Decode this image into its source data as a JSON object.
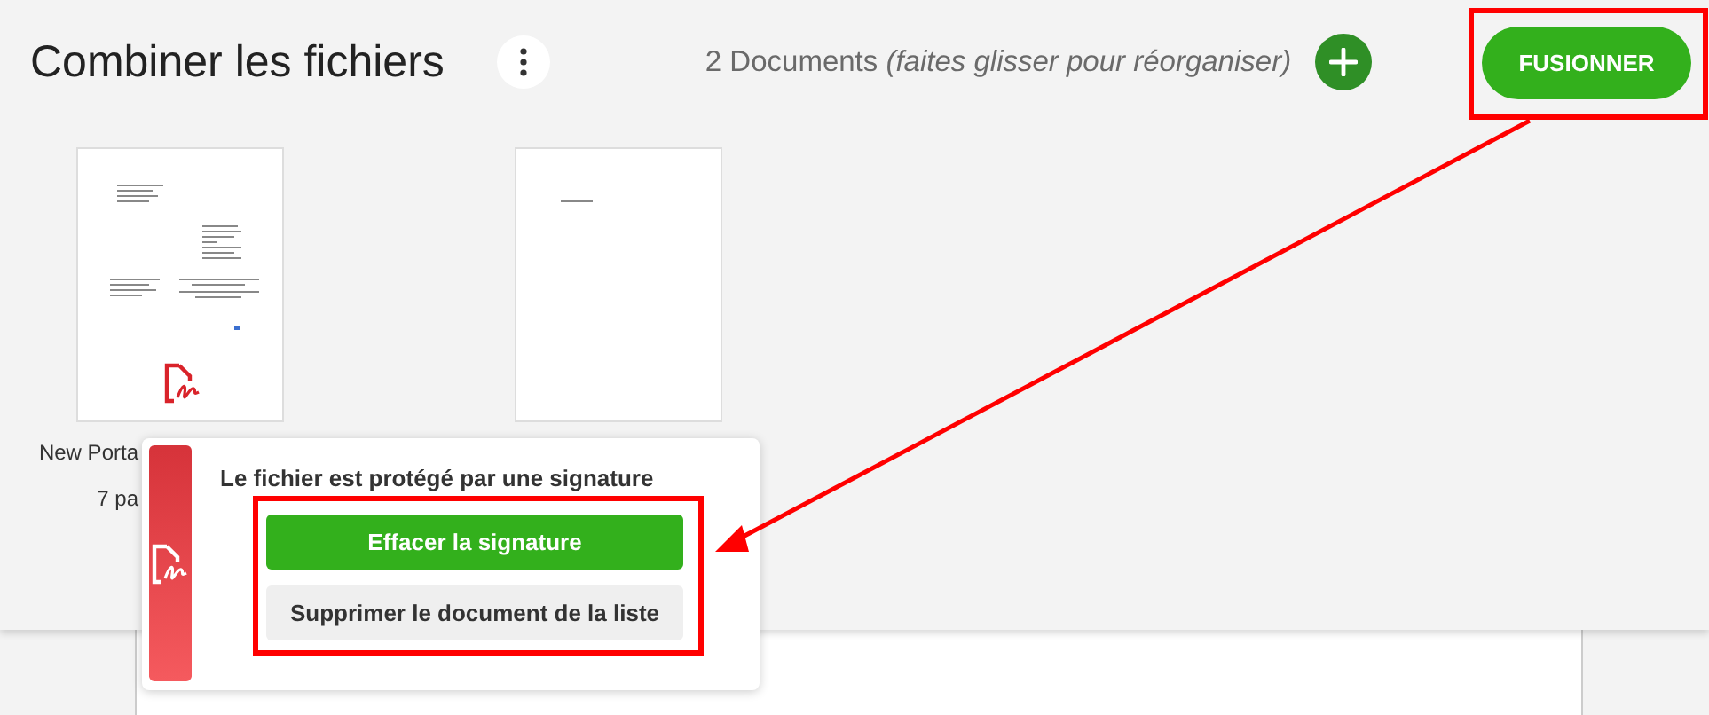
{
  "header": {
    "title": "Combiner les fichiers",
    "count": "2 Documents",
    "hint": "(faites glisser pour réorganiser)",
    "merge_button": "FUSIONNER"
  },
  "documents": [
    {
      "name": "New Porta",
      "pages": "7 pa",
      "signed": true
    },
    {
      "signed": false
    }
  ],
  "popup": {
    "message": "Le fichier est protégé par une signature",
    "actions": [
      {
        "label": "Effacer la signature",
        "kind": "primary"
      },
      {
        "label": "Supprimer le document de la liste",
        "kind": "secondary"
      }
    ]
  }
}
